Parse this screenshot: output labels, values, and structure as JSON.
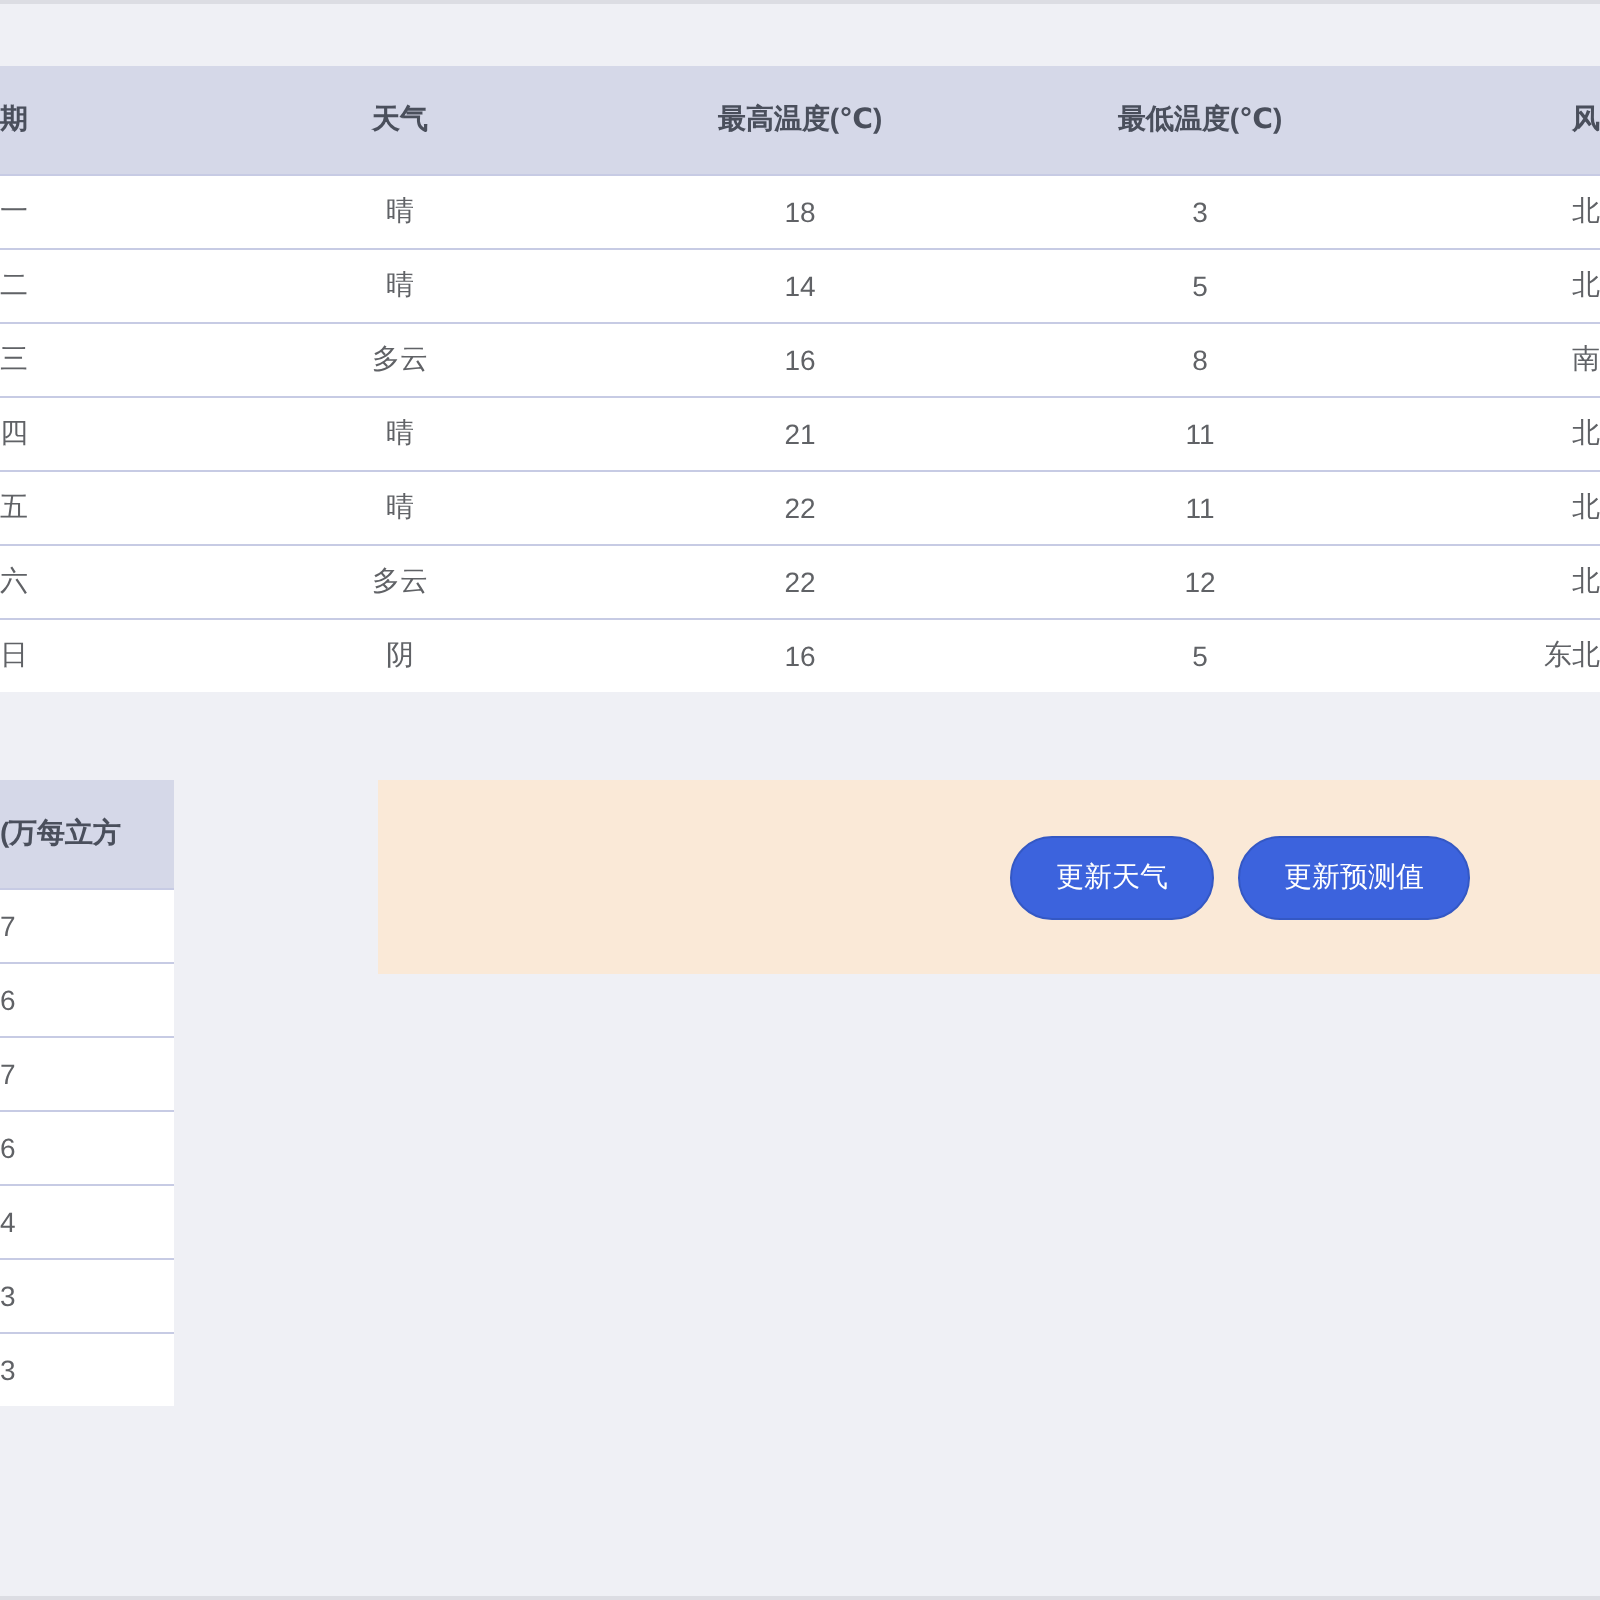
{
  "weather_table": {
    "columns": [
      "期",
      "天气",
      "最高温度(℃)",
      "最低温度(℃)",
      "风"
    ],
    "rows": [
      [
        "一",
        "晴",
        "18",
        "3",
        "北"
      ],
      [
        "二",
        "晴",
        "14",
        "5",
        "北"
      ],
      [
        "三",
        "多云",
        "16",
        "8",
        "南"
      ],
      [
        "四",
        "晴",
        "21",
        "11",
        "北"
      ],
      [
        "五",
        "晴",
        "22",
        "11",
        "北"
      ],
      [
        "六",
        "多云",
        "22",
        "12",
        "北"
      ],
      [
        "日",
        "阴",
        "16",
        "5",
        "东北"
      ]
    ]
  },
  "forecast_table": {
    "column": "(万每立方",
    "rows": [
      "7",
      "6",
      "7",
      "6",
      "4",
      "3",
      "3"
    ]
  },
  "actions": [
    "更新天气",
    "更新预测值"
  ]
}
